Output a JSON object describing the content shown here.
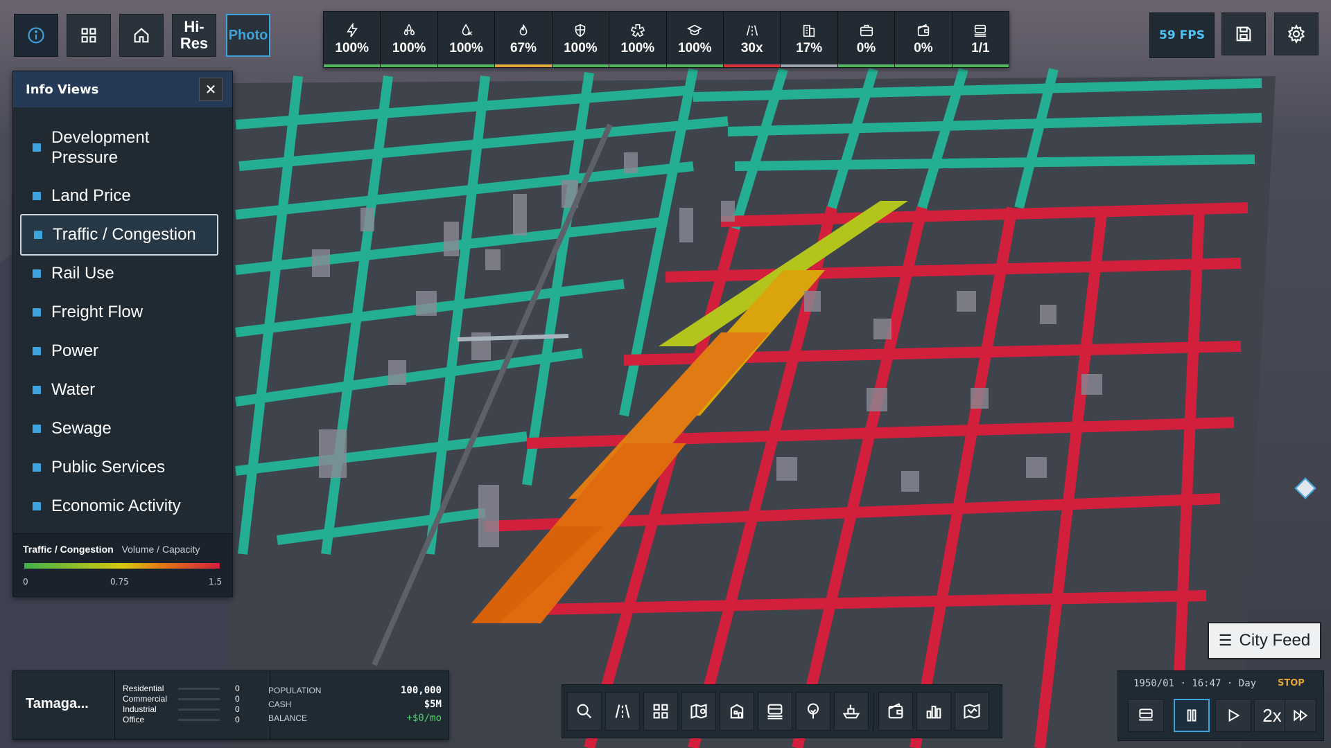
{
  "top_left_buttons": {
    "info_icon": "info-circle-icon",
    "grid_icon": "grid-icon",
    "home_icon": "home-icon",
    "hires_label_1": "Hi-",
    "hires_label_2": "Res",
    "photo_label": "Photo"
  },
  "stats": [
    {
      "icon": "power-icon",
      "value": "100%",
      "color": "#4fb85c"
    },
    {
      "icon": "water-drops-icon",
      "value": "100%",
      "color": "#4fb85c"
    },
    {
      "icon": "sewage-drop-icon",
      "value": "100%",
      "color": "#4fb85c"
    },
    {
      "icon": "fire-icon",
      "value": "67%",
      "color": "#e0a43a"
    },
    {
      "icon": "police-shield-icon",
      "value": "100%",
      "color": "#4fb85c"
    },
    {
      "icon": "health-icon",
      "value": "100%",
      "color": "#4fb85c"
    },
    {
      "icon": "education-cap-icon",
      "value": "100%",
      "color": "#4fb85c"
    },
    {
      "icon": "road-icon",
      "value": "30x",
      "color": "#d6343a"
    },
    {
      "icon": "building-icon",
      "value": "17%",
      "color": "#9aa3ac"
    },
    {
      "icon": "briefcase-icon",
      "value": "0%",
      "color": "#4fb85c"
    },
    {
      "icon": "wallet-icon",
      "value": "0%",
      "color": "#4fb85c"
    },
    {
      "icon": "rail-icon",
      "value": "1/1",
      "color": "#4fb85c"
    }
  ],
  "top_right": {
    "fps": "59 FPS",
    "save_icon": "save-icon",
    "settings_icon": "gear-icon"
  },
  "info_views": {
    "title": "Info Views",
    "items": [
      {
        "label_1": "Development",
        "label_2": "Pressure"
      },
      {
        "label": "Land Price"
      },
      {
        "label": "Traffic / Congestion",
        "active": true
      },
      {
        "label": "Rail Use"
      },
      {
        "label": "Freight Flow"
      },
      {
        "label": "Power"
      },
      {
        "label": "Water"
      },
      {
        "label": "Sewage"
      },
      {
        "label": "Public Services"
      },
      {
        "label": "Economic Activity"
      }
    ],
    "legend": {
      "title": "Traffic / Congestion",
      "subtitle": "Volume / Capacity",
      "min": "0",
      "mid": "0.75",
      "max": "1.5"
    }
  },
  "city_feed": {
    "label": "City Feed"
  },
  "city_info": {
    "name": "Tamaga...",
    "zones": [
      {
        "label": "Residential",
        "value": "0"
      },
      {
        "label": "Commercial",
        "value": "0"
      },
      {
        "label": "Industrial",
        "value": "0"
      },
      {
        "label": "Office",
        "value": "0"
      }
    ],
    "population_label": "POPULATION",
    "population": "100,000",
    "cash_label": "CASH",
    "cash": "$5M",
    "balance_label": "BALANCE",
    "balance": "+$0/mo"
  },
  "toolbar": [
    "search-icon",
    "road-icon",
    "zones-grid-icon",
    "map-pin-icon",
    "building-plan-icon",
    "rail-icon",
    "tree-icon",
    "ship-icon",
    "wallet-icon",
    "chart-icon",
    "map-icon"
  ],
  "time": {
    "date": "1950/01",
    "clock": "16:47",
    "period": "Day",
    "stop": "STOP",
    "speed": "2x"
  }
}
